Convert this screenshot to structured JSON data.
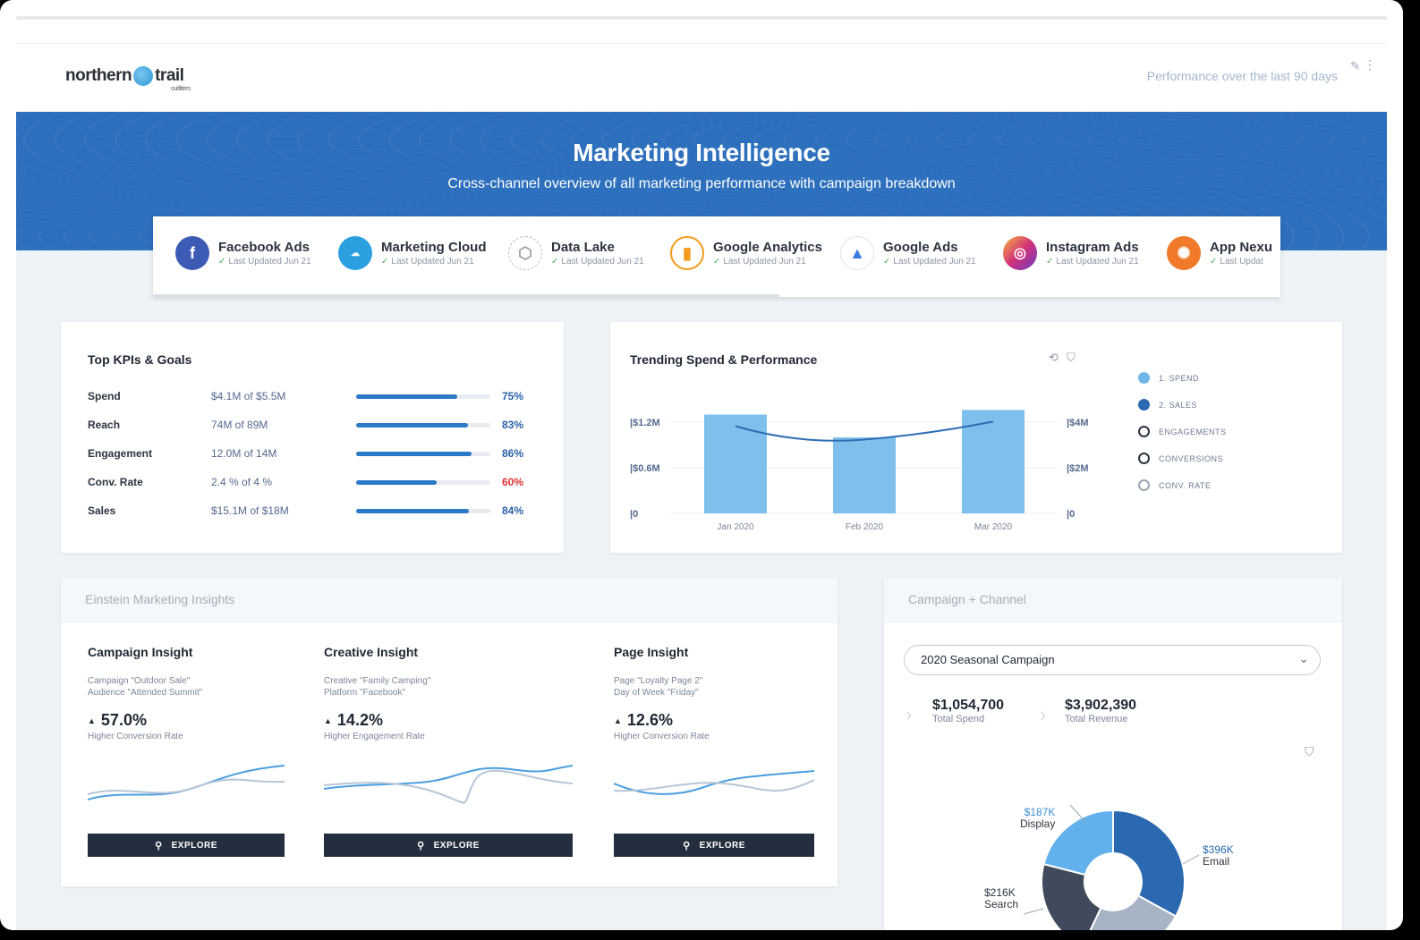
{
  "header": {
    "logo_left": "northern",
    "logo_right": "trail",
    "logo_sub": "outfitters",
    "performance_text": "Performance over the last 90 days"
  },
  "hero": {
    "title": "Marketing Intelligence",
    "subtitle": "Cross-channel overview of all marketing performance with campaign breakdown"
  },
  "sources": [
    {
      "name": "Facebook Ads",
      "updated": "Last Updated Jun 21",
      "icon": "facebook-icon",
      "color": "#3b5bb5"
    },
    {
      "name": "Marketing Cloud",
      "updated": "Last Updated Jun 21",
      "icon": "salesforce-cloud-icon",
      "color": "#2b9fe0"
    },
    {
      "name": "Data Lake",
      "updated": "Last Updated Jun 21",
      "icon": "data-lake-icon",
      "color": "#c8ccd2"
    },
    {
      "name": "Google Analytics",
      "updated": "Last Updated Jun 21",
      "icon": "google-analytics-icon",
      "color": "#f39b1b"
    },
    {
      "name": "Google Ads",
      "updated": "Last Updated Jun 21",
      "icon": "google-ads-icon",
      "color": "#ffffff"
    },
    {
      "name": "Instagram Ads",
      "updated": "Last Updated Jun 21",
      "icon": "instagram-icon",
      "color": "#c23599"
    },
    {
      "name": "App Nexu",
      "updated": "Last Updat",
      "icon": "app-nexus-icon",
      "color": "#f07a2a"
    }
  ],
  "kpis": {
    "title": "Top KPIs & Goals",
    "rows": [
      {
        "label": "Spend",
        "value": "$4.1M of $5.5M",
        "pct_text": "75%",
        "pct": 75,
        "warn": false
      },
      {
        "label": "Reach",
        "value": "74M of 89M",
        "pct_text": "83%",
        "pct": 83,
        "warn": false
      },
      {
        "label": "Engagement",
        "value": "12.0M of 14M",
        "pct_text": "86%",
        "pct": 86,
        "warn": false
      },
      {
        "label": "Conv. Rate",
        "value": "2.4 % of 4 %",
        "pct_text": "60%",
        "pct": 60,
        "warn": true
      },
      {
        "label": "Sales",
        "value": "$15.1M of $18M",
        "pct_text": "84%",
        "pct": 84,
        "warn": false
      }
    ]
  },
  "trend": {
    "title": "Trending Spend & Performance",
    "legend": [
      {
        "label": "1. SPEND",
        "style": "filled-light"
      },
      {
        "label": "2. SALES",
        "style": "filled-dark"
      },
      {
        "label": "ENGAGEMENTS",
        "style": "ring-dark"
      },
      {
        "label": "CONVERSIONS",
        "style": "ring-dark"
      },
      {
        "label": "CONV. RATE",
        "style": "ring-light"
      }
    ],
    "left_ticks": [
      "$1.2M",
      "$0.6M",
      "0"
    ],
    "right_ticks": [
      "$4M",
      "$2M",
      "0"
    ]
  },
  "chart_data": {
    "type": "bar",
    "categories": [
      "Jan 2020",
      "Feb 2020",
      "Mar 2020"
    ],
    "series": [
      {
        "name": "1. SPEND",
        "type": "bar",
        "values": [
          1.3,
          1.0,
          1.36
        ]
      },
      {
        "name": "2. SALES",
        "type": "line",
        "values": [
          3.8,
          3.45,
          4.0
        ]
      }
    ],
    "ylim": [
      0,
      1.6
    ],
    "y2lim": [
      0,
      5.3
    ],
    "colors": {
      "bar": "#7fbfeb",
      "line": "#2d6db5"
    }
  },
  "insights": {
    "section_title": "Einstein Marketing Insights",
    "cards": [
      {
        "title": "Campaign Insight",
        "meta1": "Campaign \"Outdoor Sale\"",
        "meta2": "Audience \"Attended Summit\"",
        "value": "57.0%",
        "caption": "Higher Conversion Rate",
        "button": "EXPLORE"
      },
      {
        "title": "Creative Insight",
        "meta1": "Creative \"Family Camping\"",
        "meta2": "Platform \"Facebook\"",
        "value": "14.2%",
        "caption": "Higher Engagement Rate",
        "button": "EXPLORE"
      },
      {
        "title": "Page Insight",
        "meta1": "Page \"Loyalty Page 2\"",
        "meta2": "Day of Week \"Friday\"",
        "value": "12.6%",
        "caption": "Higher Conversion Rate",
        "button": "EXPLORE"
      }
    ]
  },
  "campaign": {
    "section_title": "Campaign + Channel",
    "selected": "2020 Seasonal Campaign",
    "total_spend": "$1,054,700",
    "total_spend_label": "Total Spend",
    "total_revenue": "$3,902,390",
    "total_revenue_label": "Total Revenue",
    "slices": [
      {
        "value": "$187K",
        "label": "Display",
        "color": "#62b1ec"
      },
      {
        "value": "$396K",
        "label": "Email",
        "color": "#2a68b0"
      },
      {
        "value": "$216K",
        "label": "Search",
        "color": "#3f4b5c"
      },
      {
        "value": "",
        "label": "",
        "color": "#a7b4c6"
      }
    ]
  }
}
